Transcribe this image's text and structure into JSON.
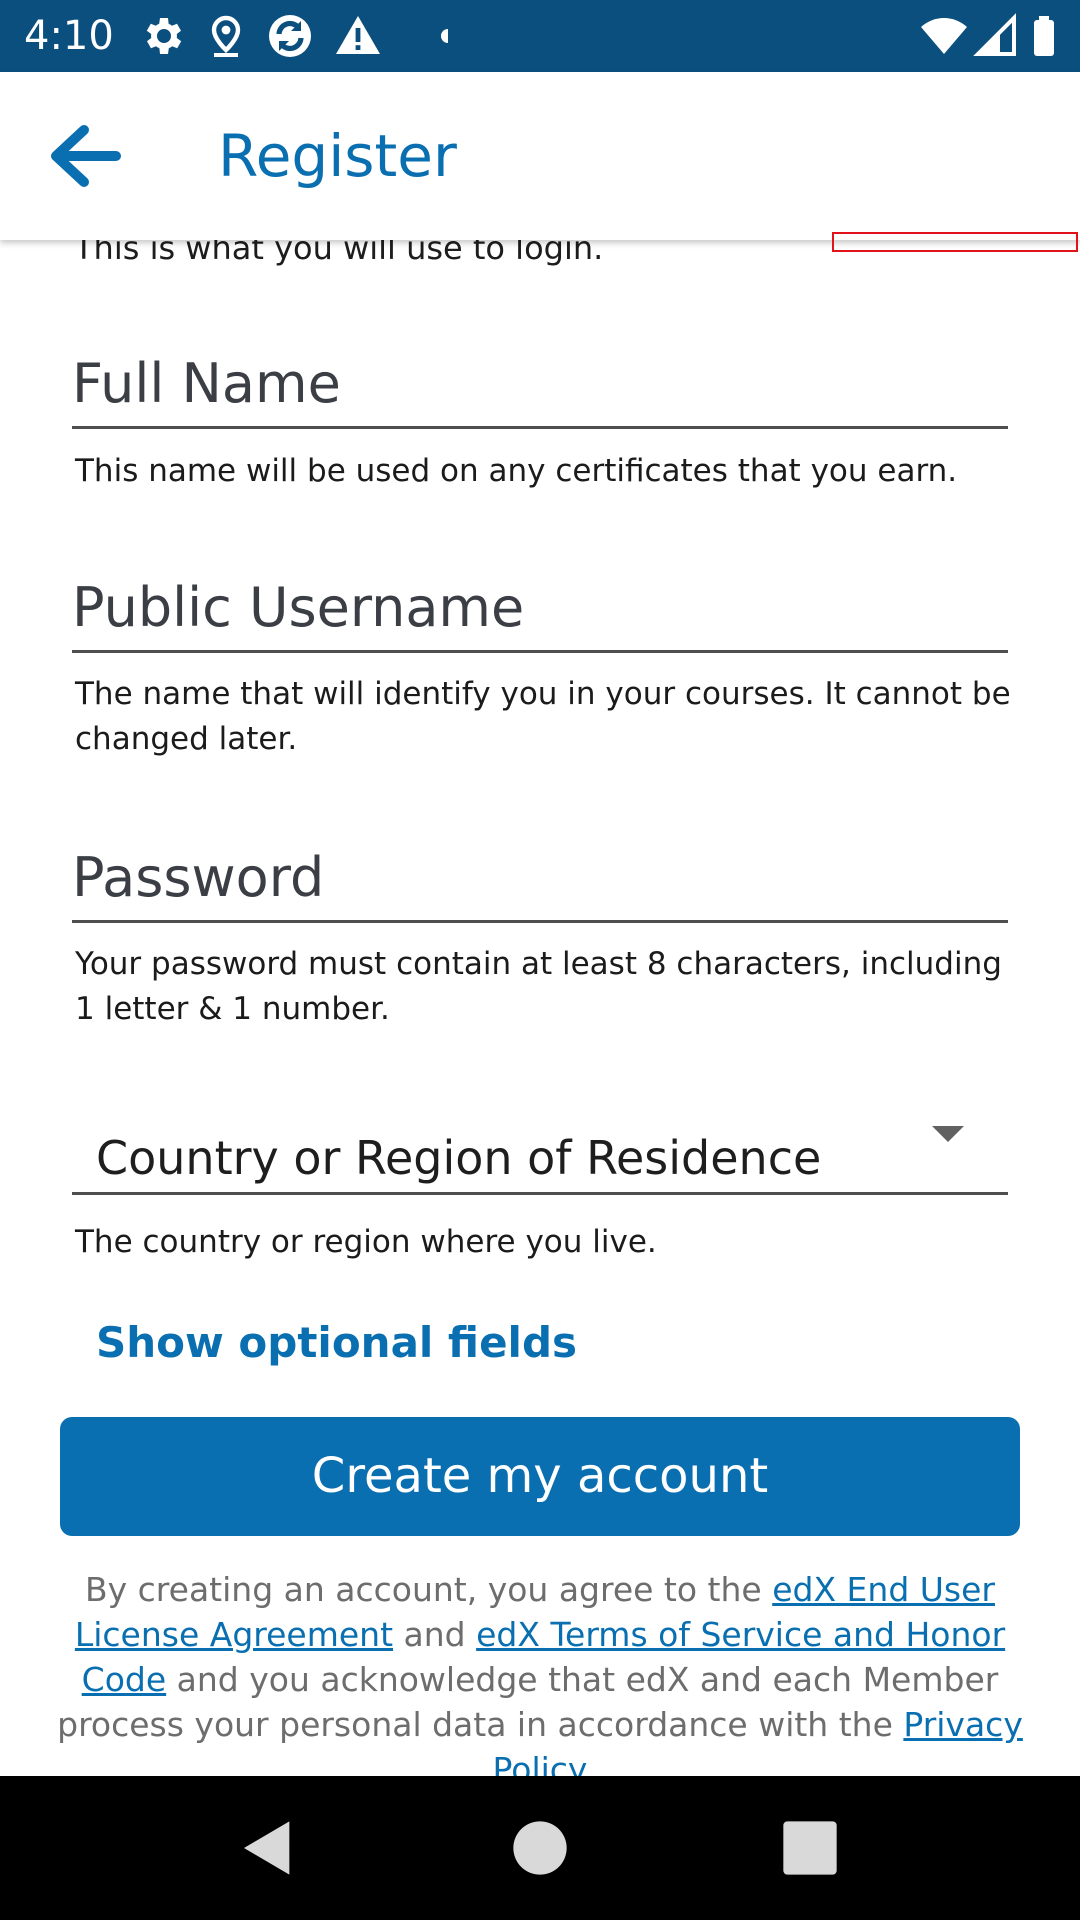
{
  "status_bar": {
    "time": "4:10",
    "icons": [
      "gear-icon",
      "location-pin-icon",
      "sync-icon",
      "warning-icon",
      "dot-icon",
      "wifi-icon",
      "signal-icon",
      "battery-icon"
    ]
  },
  "app_bar": {
    "title": "Register",
    "back_icon": "back-arrow-icon"
  },
  "form": {
    "cut_hint": "This is what you will use to login.",
    "full_name": {
      "label": "Full Name",
      "hint": "This name will be used on any certificates that you earn."
    },
    "username": {
      "label": "Public Username",
      "hint": "The name that will identify you in your courses. It cannot be changed later."
    },
    "password": {
      "label": "Password",
      "hint": "Your password must contain at least 8 characters, including 1 letter & 1 number."
    },
    "country": {
      "label": "Country or Region of Residence",
      "hint": "The country or region where you live."
    },
    "optional_link": "Show optional fields",
    "create_button": "Create my account"
  },
  "legal": {
    "part1": "By creating an account, you agree to the ",
    "link1": "edX End User License Agreement",
    "part2": " and ",
    "link2": "edX Terms of Service and Honor Code",
    "part3": " and you acknowledge that edX and each Member process your personal data in accordance with the ",
    "link3": "Privacy Policy"
  },
  "colors": {
    "status_bar": "#0b4f7e",
    "accent": "#0a6fb0",
    "nav_bar": "#000000"
  }
}
